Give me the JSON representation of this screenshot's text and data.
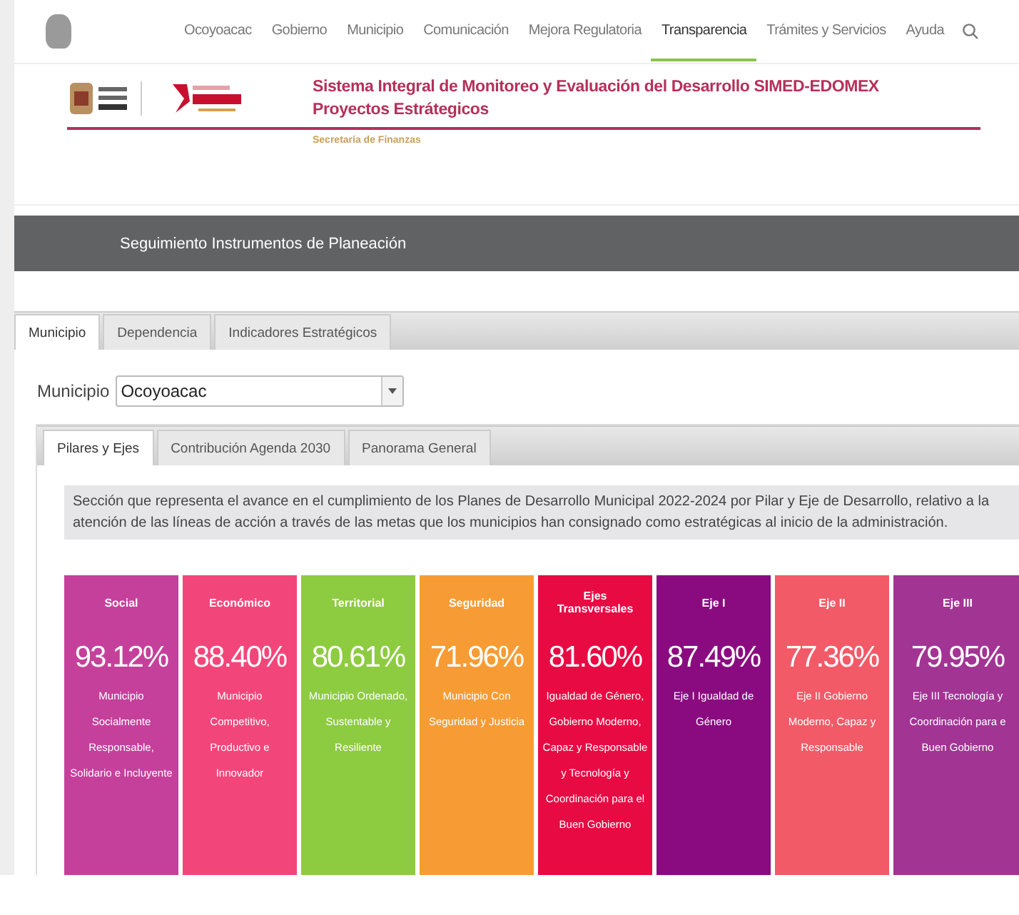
{
  "nav": {
    "items": [
      {
        "label": "Ocoyoacac",
        "selected": false
      },
      {
        "label": "Gobierno",
        "selected": false
      },
      {
        "label": "Municipio",
        "selected": false
      },
      {
        "label": "Comunicación",
        "selected": false
      },
      {
        "label": "Mejora Regulatoria",
        "selected": false
      },
      {
        "label": "Transparencia",
        "selected": true
      },
      {
        "label": "Trámites y Servicios",
        "selected": false
      },
      {
        "label": "Ayuda",
        "selected": false
      }
    ]
  },
  "header": {
    "title": "Sistema Integral de Monitoreo y Evaluación  del Desarrollo  SIMED-EDOMEX",
    "subtitle": "Proyectos Estrátegicos",
    "department": "Secretaría de Finanzas"
  },
  "banner": {
    "title": "Seguimiento Instrumentos de Planeación"
  },
  "tabs": [
    {
      "label": "Municipio",
      "selected": true
    },
    {
      "label": "Dependencia",
      "selected": false
    },
    {
      "label": "Indicadores Estratégicos",
      "selected": false
    }
  ],
  "municipio_select": {
    "label": "Municipio",
    "value": "Ocoyoacac"
  },
  "subtabs": [
    {
      "label": "Pilares y Ejes",
      "selected": true
    },
    {
      "label": "Contribución Agenda 2030",
      "selected": false
    },
    {
      "label": "Panorama General",
      "selected": false
    }
  ],
  "description": "Sección que representa el avance en el cumplimiento de los Planes de Desarrollo Municipal 2022-2024 por Pilar y Eje de Desarrollo, relativo a la atención de las líneas de acción a través de las metas que los municipios han consignado como estratégicas al inicio de la administración.",
  "cards": [
    {
      "title": "Social",
      "percent": "93.12%",
      "text": "Municipio Socialmente Responsable, Solidario e Incluyente",
      "color": "#c5409b"
    },
    {
      "title": "Económico",
      "percent": "88.40%",
      "text": "Municipio Competitivo, Productivo e Innovador",
      "color": "#f2467a"
    },
    {
      "title": "Territorial",
      "percent": "80.61%",
      "text": "Municipio Ordenado, Sustentable y Resiliente",
      "color": "#8dcb40"
    },
    {
      "title": "Seguridad",
      "percent": "71.96%",
      "text": "Municipio Con Seguridad y Justicia",
      "color": "#f79c34"
    },
    {
      "title": "Ejes Transversales",
      "percent": "81.60%",
      "text": "Igualdad de Género, Gobierno Moderno, Capaz y Responsable y Tecnología y Coordinación para el Buen Gobierno",
      "color": "#e80a43"
    },
    {
      "title": "Eje I",
      "percent": "87.49%",
      "text": "Eje I Igualdad de Género",
      "color": "#8a0b80"
    },
    {
      "title": "Eje II",
      "percent": "77.36%",
      "text": "Eje II Gobierno Moderno, Capaz y Responsable",
      "color": "#f25a68"
    },
    {
      "title": "Eje III",
      "percent": "79.95%",
      "text": "Eje III Tecnología y Coordinación para e Buen Gobierno",
      "color": "#a23494"
    }
  ]
}
